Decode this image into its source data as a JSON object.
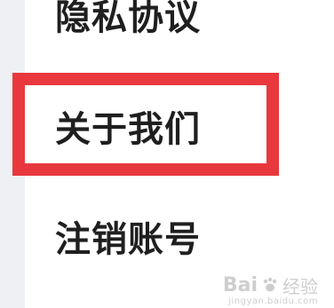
{
  "menu": {
    "items": [
      {
        "label": "隐私协议"
      },
      {
        "label": "关于我们",
        "highlighted": true
      },
      {
        "label": "注销账号"
      }
    ]
  },
  "watermark": {
    "brand": "Bai",
    "sub": "经验",
    "url": "jingyan.baidu.com"
  },
  "colors": {
    "highlight": "#e8383d",
    "text": "#1f1f1f",
    "side_strip": "#eef0f4"
  }
}
